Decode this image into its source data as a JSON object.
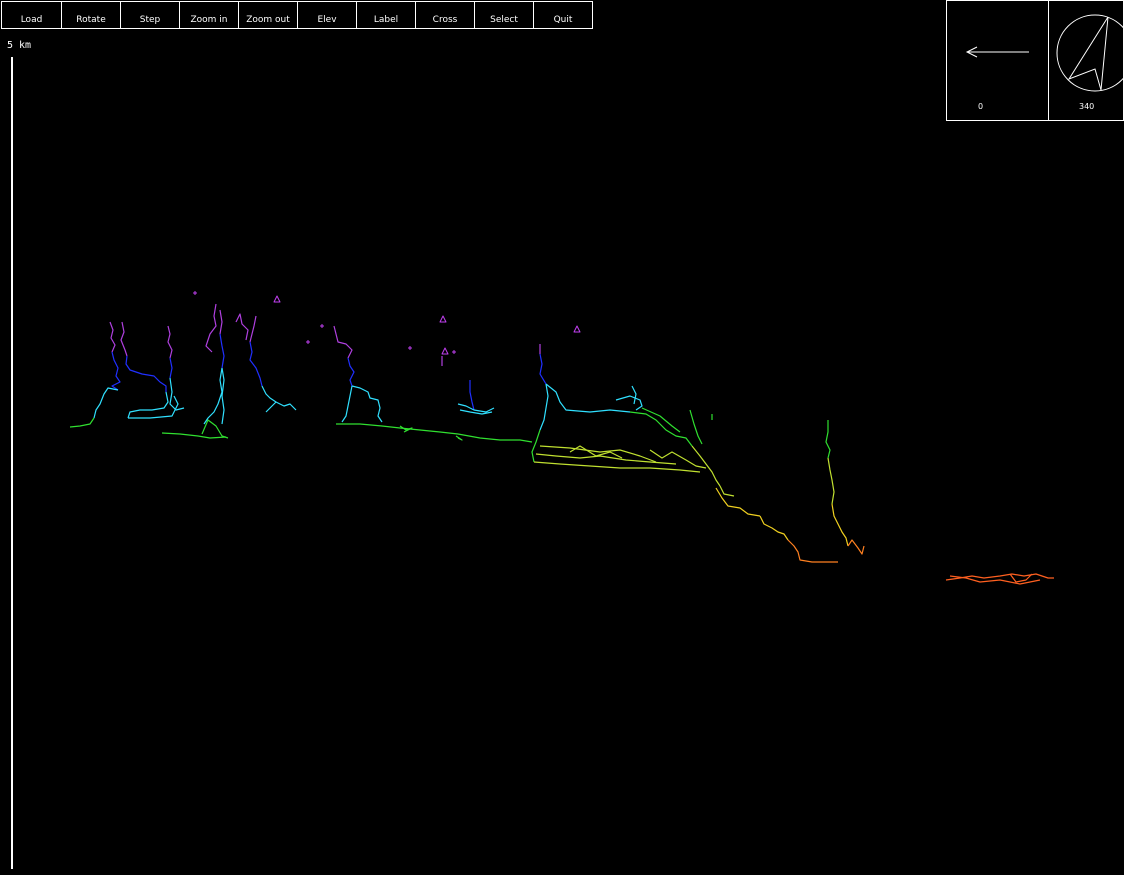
{
  "toolbar": {
    "buttons": [
      "Load",
      "Rotate",
      "Step",
      "Zoom in",
      "Zoom out",
      "Elev",
      "Label",
      "Cross",
      "Select",
      "Quit"
    ]
  },
  "scale": {
    "label": "5 km"
  },
  "nav": {
    "elevation_value": "0",
    "rotation_value": "340"
  },
  "colors": {
    "background": "#000000",
    "ui": "#ffffff",
    "depth_ramp": [
      "#b040e0",
      "#2030ff",
      "#30e0ff",
      "#30e030",
      "#c0e030",
      "#f0d020",
      "#ff6020"
    ]
  }
}
